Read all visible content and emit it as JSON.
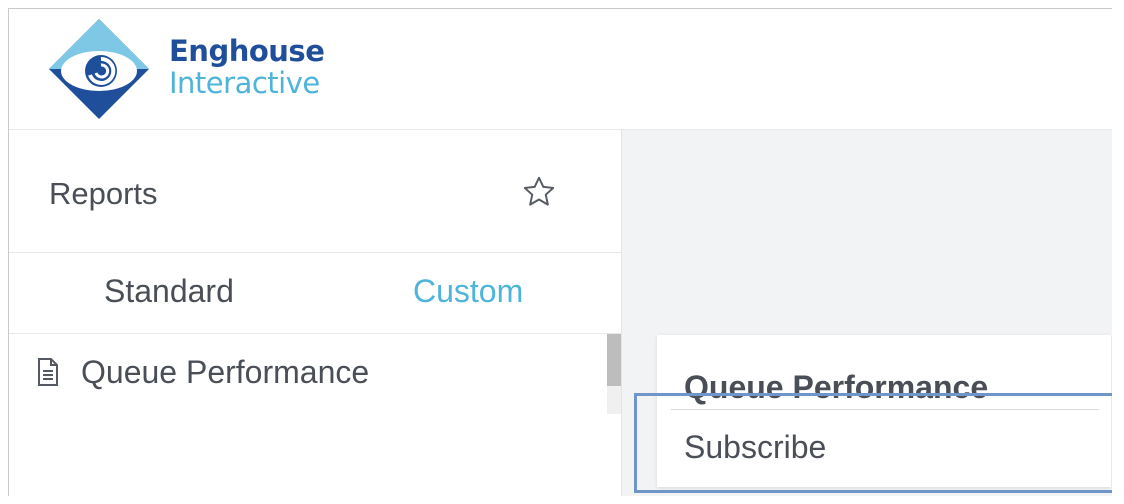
{
  "brand": {
    "line1": "Enghouse",
    "line2": "Interactive",
    "colors": {
      "dark": "#1f4f9b",
      "light": "#4fb4d9"
    }
  },
  "sidebar": {
    "title": "Reports",
    "favorite_icon": "star-icon",
    "tabs": [
      {
        "label": "Standard",
        "active": false
      },
      {
        "label": "Custom",
        "active": true
      }
    ],
    "items": [
      {
        "label": "Queue Performance",
        "icon": "document-icon"
      }
    ]
  },
  "card": {
    "title": "Queue Performance",
    "actions": [
      {
        "label": "Subscribe"
      }
    ]
  },
  "colors": {
    "accent": "#4fb4d9",
    "text": "#4a4f57",
    "focus": "#6f95c9",
    "main_bg": "#f2f3f5"
  }
}
